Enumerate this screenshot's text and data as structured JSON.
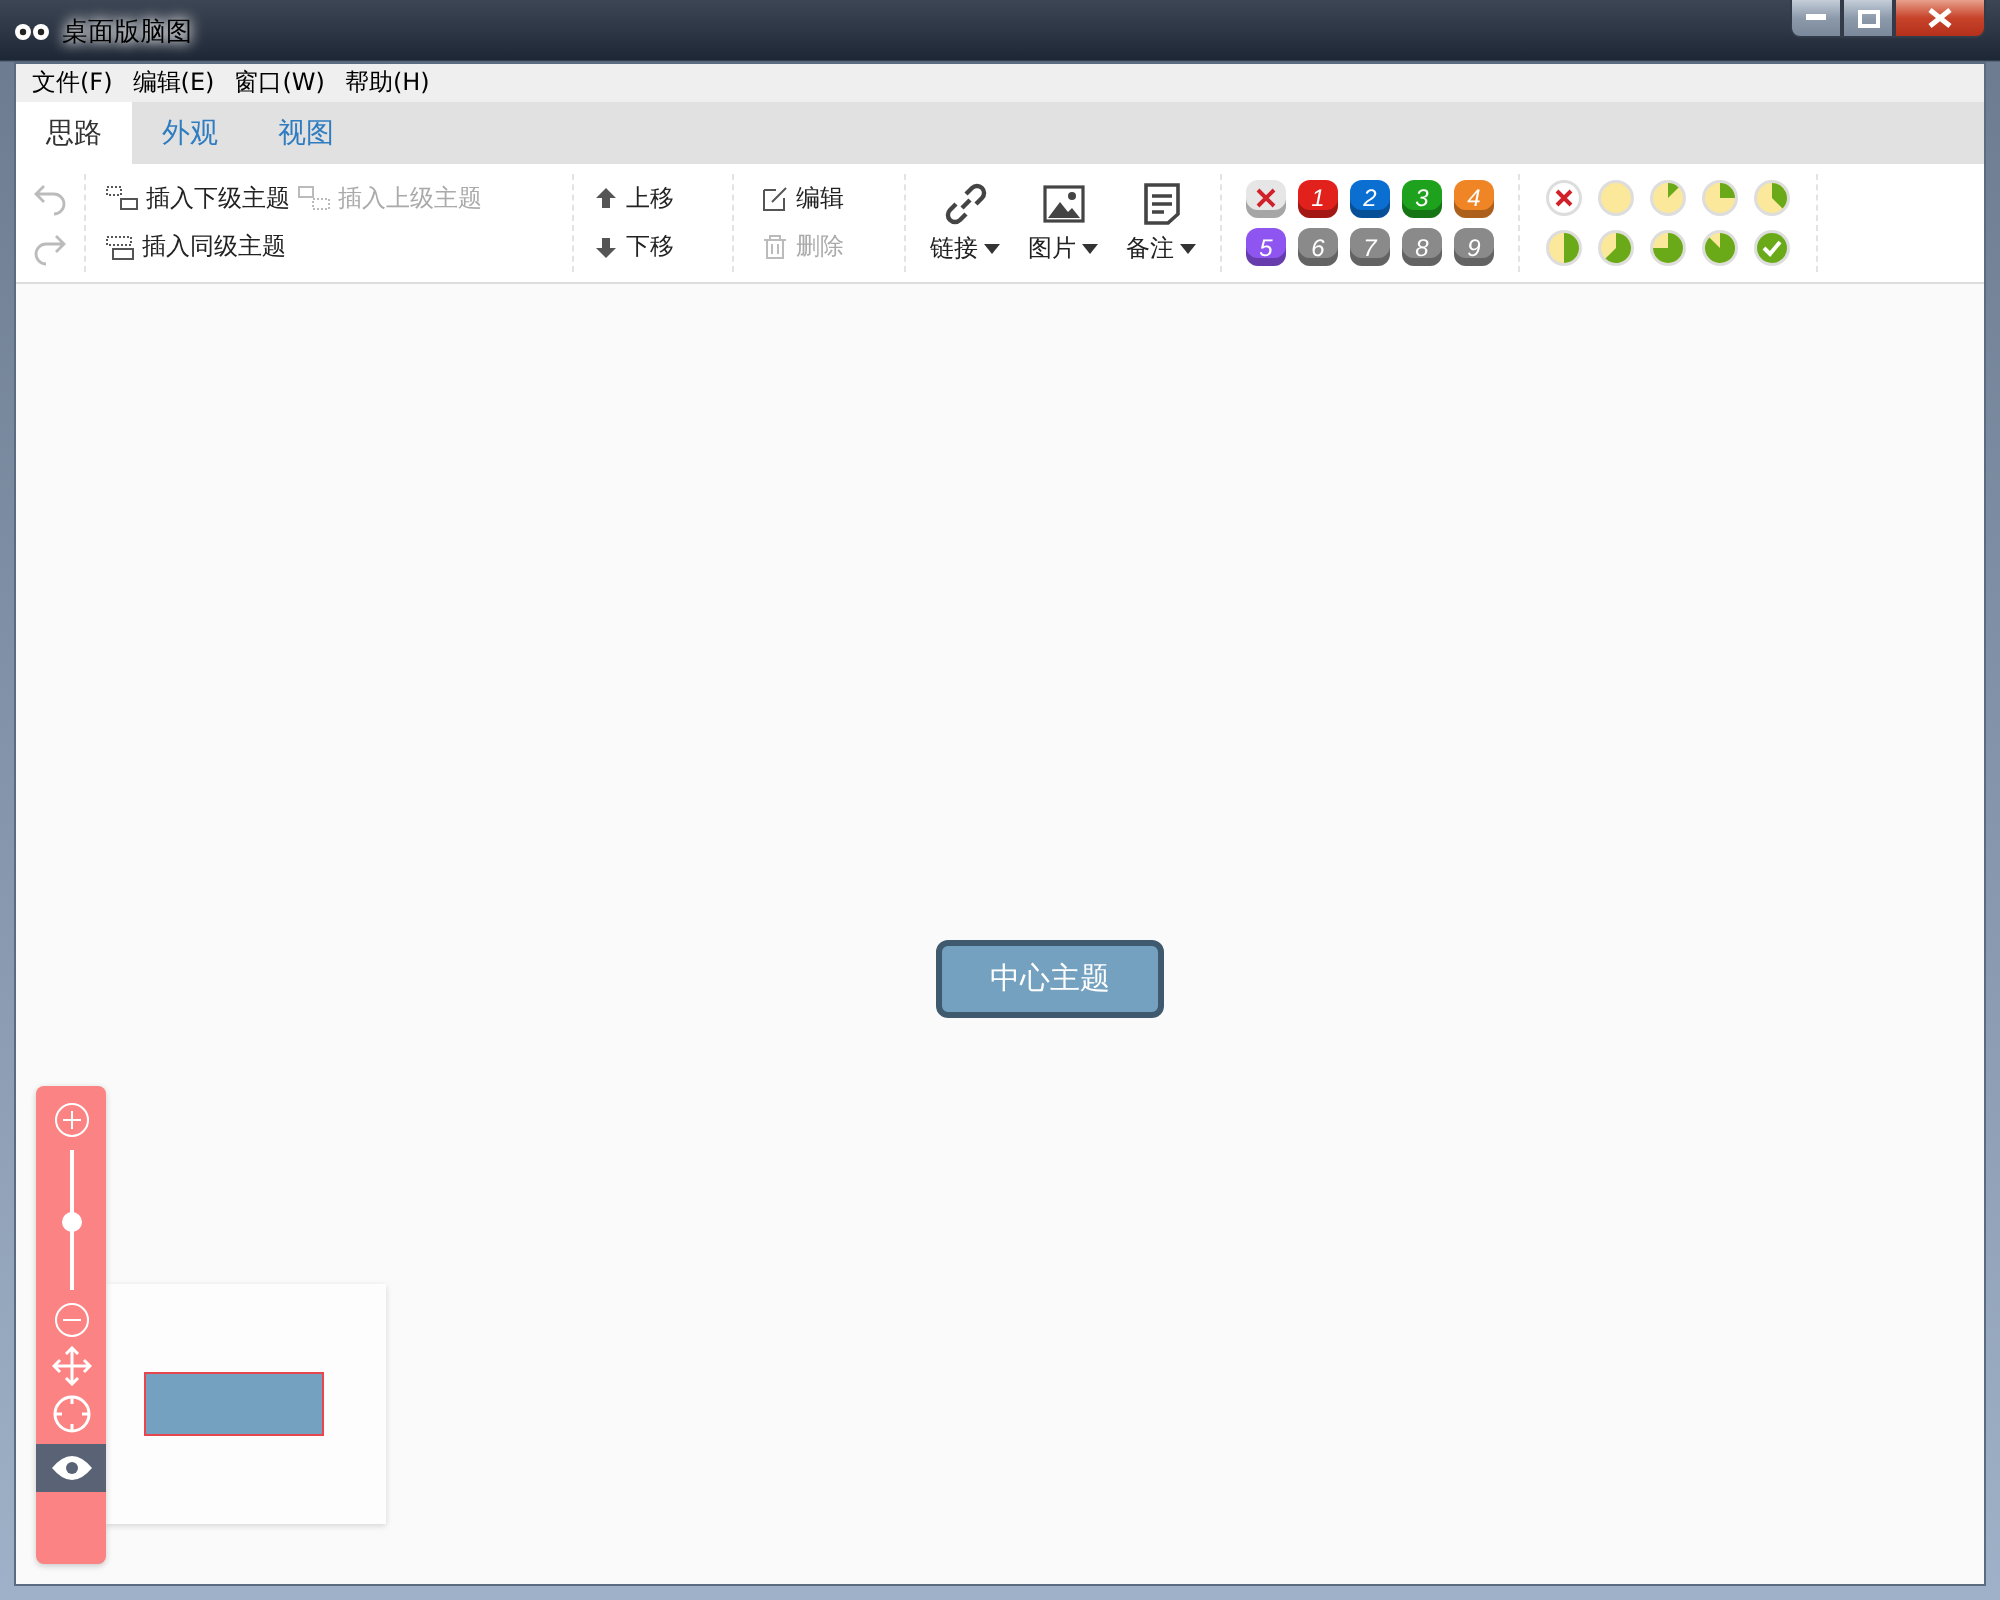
{
  "window": {
    "title": "桌面版脑图"
  },
  "menu": [
    "文件(F)",
    "编辑(E)",
    "窗口(W)",
    "帮助(H)"
  ],
  "tabs": [
    {
      "label": "思路",
      "selected": true
    },
    {
      "label": "外观",
      "selected": false
    },
    {
      "label": "视图",
      "selected": false
    }
  ],
  "history": [
    {
      "kind": "undo",
      "disabled": true
    },
    {
      "kind": "redo",
      "disabled": true
    }
  ],
  "insert": [
    {
      "kind": "child",
      "label": "插入下级主题",
      "disabled": false
    },
    {
      "kind": "parent",
      "label": "插入上级主题",
      "disabled": true
    },
    {
      "kind": "sibling",
      "label": "插入同级主题",
      "disabled": false
    }
  ],
  "move": [
    {
      "kind": "up",
      "label": "上移",
      "disabled": false
    },
    {
      "kind": "down",
      "label": "下移",
      "disabled": false
    }
  ],
  "edit": [
    {
      "kind": "edit",
      "label": "编辑",
      "disabled": false
    },
    {
      "kind": "delete",
      "label": "删除",
      "disabled": true
    }
  ],
  "attach": [
    {
      "kind": "link",
      "label": "链接"
    },
    {
      "kind": "image",
      "label": "图片"
    },
    {
      "kind": "note",
      "label": "备注"
    }
  ],
  "priorities": [
    {
      "kind": "clear"
    },
    {
      "kind": "number",
      "label": "1",
      "color": "#e2211c"
    },
    {
      "kind": "number",
      "label": "2",
      "color": "#0b6fd2"
    },
    {
      "kind": "number",
      "label": "3",
      "color": "#1ea21e"
    },
    {
      "kind": "number",
      "label": "4",
      "color": "#f08526"
    },
    {
      "kind": "number",
      "label": "5",
      "color": "#8f55f0"
    },
    {
      "kind": "number",
      "label": "6",
      "color": "#8a8a8a"
    },
    {
      "kind": "number",
      "label": "7",
      "color": "#8a8a8a"
    },
    {
      "kind": "number",
      "label": "8",
      "color": "#8a8a8a"
    },
    {
      "kind": "number",
      "label": "9",
      "color": "#8a8a8a"
    }
  ],
  "progress": [
    {
      "kind": "clear"
    },
    {
      "kind": "empty"
    },
    {
      "kind": "eighth"
    },
    {
      "kind": "quarter"
    },
    {
      "kind": "three-eighths"
    },
    {
      "kind": "half"
    },
    {
      "kind": "five-eighths"
    },
    {
      "kind": "three-quarters"
    },
    {
      "kind": "seven-eighths"
    },
    {
      "kind": "done"
    }
  ],
  "canvas": {
    "root_topic": "中心主题"
  },
  "zoom": {
    "level": 0.48
  }
}
